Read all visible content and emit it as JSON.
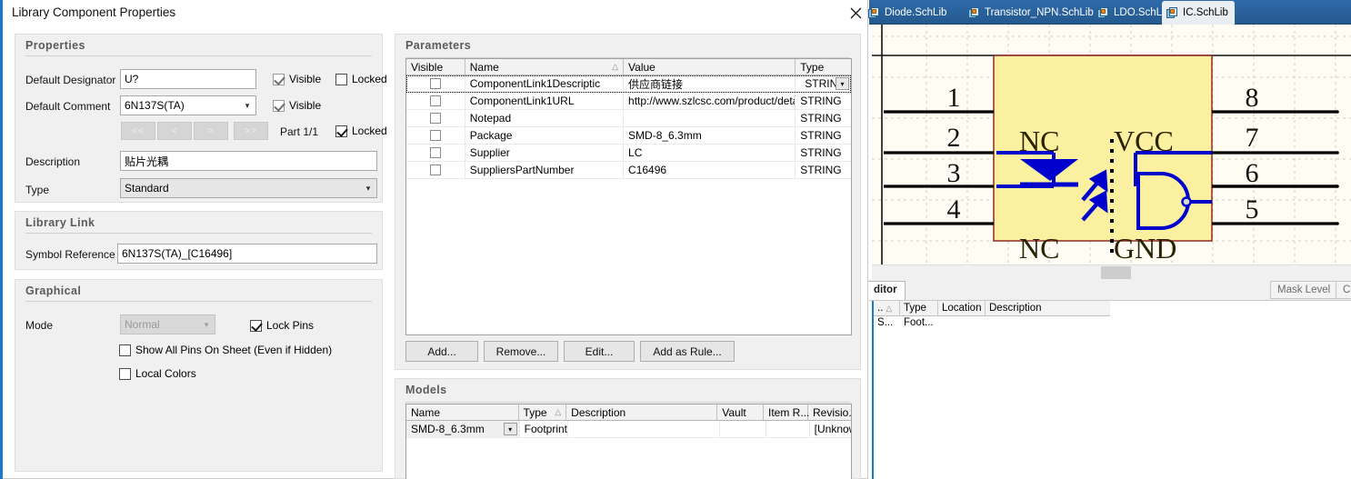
{
  "dialog": {
    "title": "Library Component Properties",
    "close_icon": "close-icon"
  },
  "properties": {
    "group_title": "Properties",
    "default_designator_label": "Default Designator",
    "default_designator_value": "U?",
    "designator_visible_label": "Visible",
    "designator_locked_label": "Locked",
    "default_comment_label": "Default Comment",
    "default_comment_value": "6N137S(TA)",
    "comment_visible_label": "Visible",
    "nav_first": "<<",
    "nav_prev": "<",
    "nav_next": ">",
    "nav_last": ">>",
    "part_label": "Part 1/1",
    "part_locked_label": "Locked",
    "description_label": "Description",
    "description_value": "贴片光耦",
    "type_label": "Type",
    "type_value": "Standard"
  },
  "library_link": {
    "group_title": "Library Link",
    "symbol_reference_label": "Symbol Reference",
    "symbol_reference_value": "6N137S(TA)_[C16496]"
  },
  "graphical": {
    "group_title": "Graphical",
    "mode_label": "Mode",
    "mode_value": "Normal",
    "lock_pins_label": "Lock Pins",
    "show_all_pins_label": "Show All Pins On Sheet (Even if Hidden)",
    "local_colors_label": "Local Colors"
  },
  "parameters": {
    "group_title": "Parameters",
    "columns": [
      "Visible",
      "Name",
      "Value",
      "Type"
    ],
    "name_sort_icon": "sort-ascending-icon",
    "rows": [
      {
        "visible": false,
        "name": "ComponentLink1Descriptic",
        "value": "供应商链接",
        "type": "STRING",
        "has_dropdown": true
      },
      {
        "visible": false,
        "name": "ComponentLink1URL",
        "value": "http://www.szlcsc.com/product/deta",
        "type": "STRING",
        "has_dropdown": false
      },
      {
        "visible": false,
        "name": "Notepad",
        "value": "",
        "type": "STRING",
        "has_dropdown": false
      },
      {
        "visible": false,
        "name": "Package",
        "value": "SMD-8_6.3mm",
        "type": "STRING",
        "has_dropdown": false
      },
      {
        "visible": false,
        "name": "Supplier",
        "value": "LC",
        "type": "STRING",
        "has_dropdown": false
      },
      {
        "visible": false,
        "name": "SuppliersPartNumber",
        "value": "C16496",
        "type": "STRING",
        "has_dropdown": false
      }
    ],
    "buttons": {
      "add": "Add...",
      "remove": "Remove...",
      "edit": "Edit...",
      "add_as_rule": "Add as Rule..."
    }
  },
  "models": {
    "group_title": "Models",
    "columns": [
      "Name",
      "Type",
      "Description",
      "Vault",
      "Item R...",
      "Revisio..."
    ],
    "type_sort_icon": "sort-ascending-icon",
    "rows": [
      {
        "name": "SMD-8_6.3mm",
        "type": "Footprint",
        "description": "",
        "vault": "",
        "item_rev": "",
        "revision": "[Unknow"
      }
    ]
  },
  "editor": {
    "tabs": [
      {
        "label": "Diode.SchLib",
        "active": false,
        "icon": "schlib-icon"
      },
      {
        "label": "Transistor_NPN.SchLib",
        "active": false,
        "icon": "schlib-icon"
      },
      {
        "label": "LDO.SchLib",
        "active": false,
        "icon": "schlib-icon"
      },
      {
        "label": "IC.SchLib",
        "active": true,
        "icon": "schlib-icon"
      }
    ],
    "scroll_right_icon": "chevron-right-icon",
    "panel_tab_label": "ditor",
    "mask_level_label": "Mask Level",
    "clear_label": "Cle",
    "list_columns": [
      "..",
      "Type",
      "Location",
      "Description"
    ],
    "list_rows": [
      {
        "c0": "S...",
        "c1": "Foot...",
        "c2": "",
        "c3": ""
      }
    ]
  },
  "symbol": {
    "body_fill": "#fbf0a0",
    "body_stroke": "#8b1a1a",
    "wire_color": "#000000",
    "device_color": "#0000cd",
    "left_pin_numbers": [
      "1",
      "2",
      "3",
      "4"
    ],
    "right_pin_numbers": [
      "8",
      "7",
      "6",
      "5"
    ],
    "labels": {
      "nc_top": "NC",
      "nc_bottom": "NC",
      "vcc": "VCC",
      "gnd": "GND"
    }
  }
}
